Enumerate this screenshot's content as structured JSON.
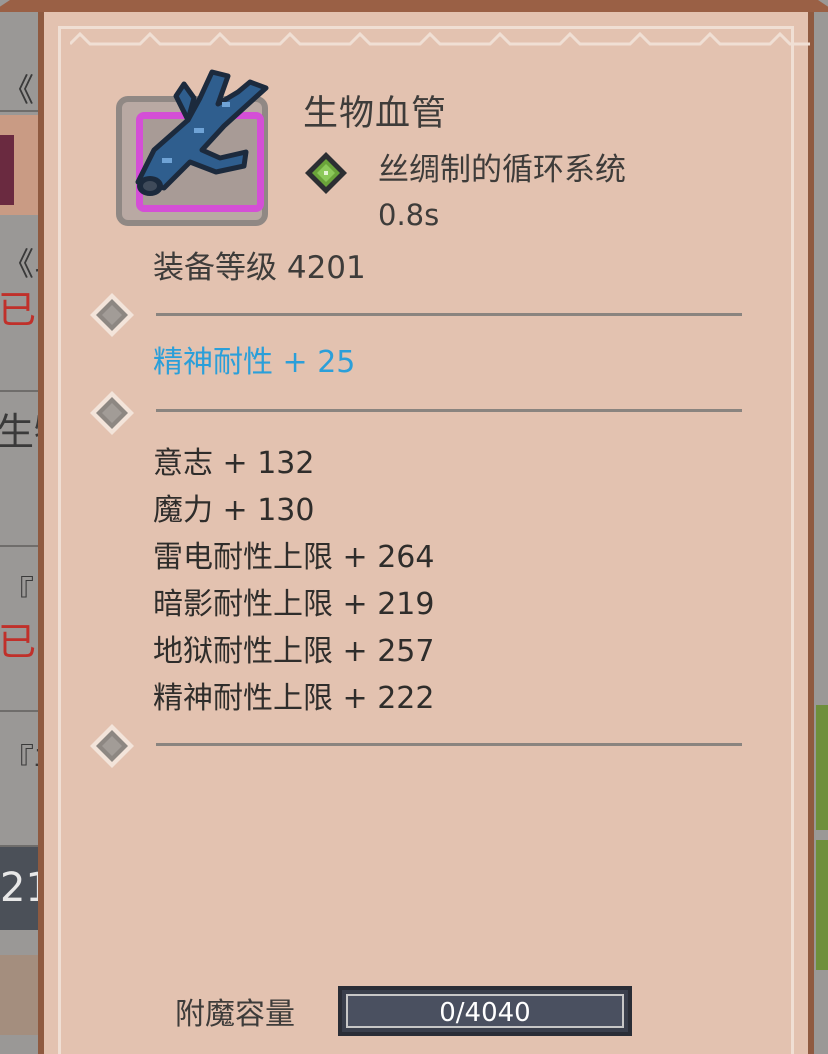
{
  "background": {
    "fragments": [
      {
        "text": "《",
        "style": "dark"
      },
      {
        "text": "《斗",
        "style": "dark"
      },
      {
        "text": "已钅",
        "style": "red"
      },
      {
        "text": "生物",
        "style": "dark"
      },
      {
        "text": "『",
        "style": "dark"
      },
      {
        "text": "已钅",
        "style": "red"
      },
      {
        "text": "『丰",
        "style": "dark"
      },
      {
        "text": "21",
        "style": "light"
      }
    ]
  },
  "item": {
    "name": "生物血管",
    "set_name": "丝绸制的循环系统",
    "cooldown": "0.8s",
    "equip_level": "装备等级 4201",
    "icon": "blood-vessel-branch-icon",
    "rarity_color": "#d44fd6"
  },
  "primary_stat": "精神耐性 + 25",
  "stats": [
    "意志 + 132",
    "魔力 + 130",
    "雷电耐性上限 + 264",
    "暗影耐性上限 + 219",
    "地狱耐性上限 + 257",
    "精神耐性上限 + 222"
  ],
  "enchant": {
    "label": "附魔容量",
    "value": "0/4040",
    "fraction": 0
  },
  "colors": {
    "panel": "#e3c2b0",
    "blue_stat": "#2b9fd9",
    "text": "#3e3c3a"
  }
}
